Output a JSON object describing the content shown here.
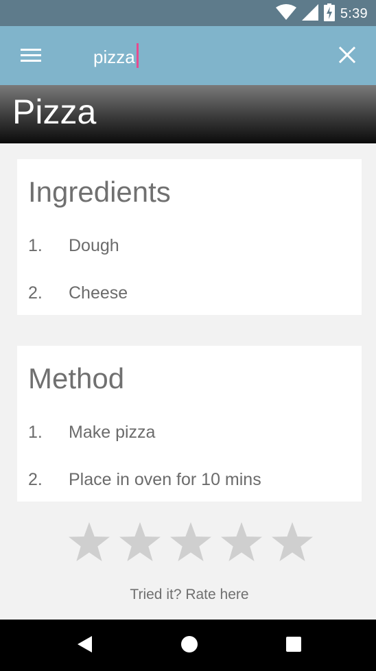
{
  "status_bar": {
    "time": "5:39",
    "icons": [
      "wifi-icon",
      "signal-icon",
      "battery-charging-icon"
    ]
  },
  "app_bar": {
    "menu_icon": "hamburger-menu-icon",
    "search_value": "pizza",
    "close_icon": "close-icon",
    "background": "#80b4cb",
    "caret_color": "#e84a8f"
  },
  "recipe": {
    "title": "Pizza",
    "ingredients": {
      "heading": "Ingredients",
      "items": [
        {
          "num": "1.",
          "text": "Dough"
        },
        {
          "num": "2.",
          "text": "Cheese"
        }
      ]
    },
    "method": {
      "heading": "Method",
      "items": [
        {
          "num": "1.",
          "text": "Make pizza"
        },
        {
          "num": "2.",
          "text": "Place in oven for 10 mins"
        }
      ]
    }
  },
  "rating": {
    "value": 0,
    "max": 5,
    "star_icon": "star-icon",
    "empty_color": "#cfcfcf",
    "label": "Tried it? Rate here"
  },
  "nav_bar": {
    "icons": [
      "back-icon",
      "home-icon",
      "recents-icon"
    ]
  }
}
